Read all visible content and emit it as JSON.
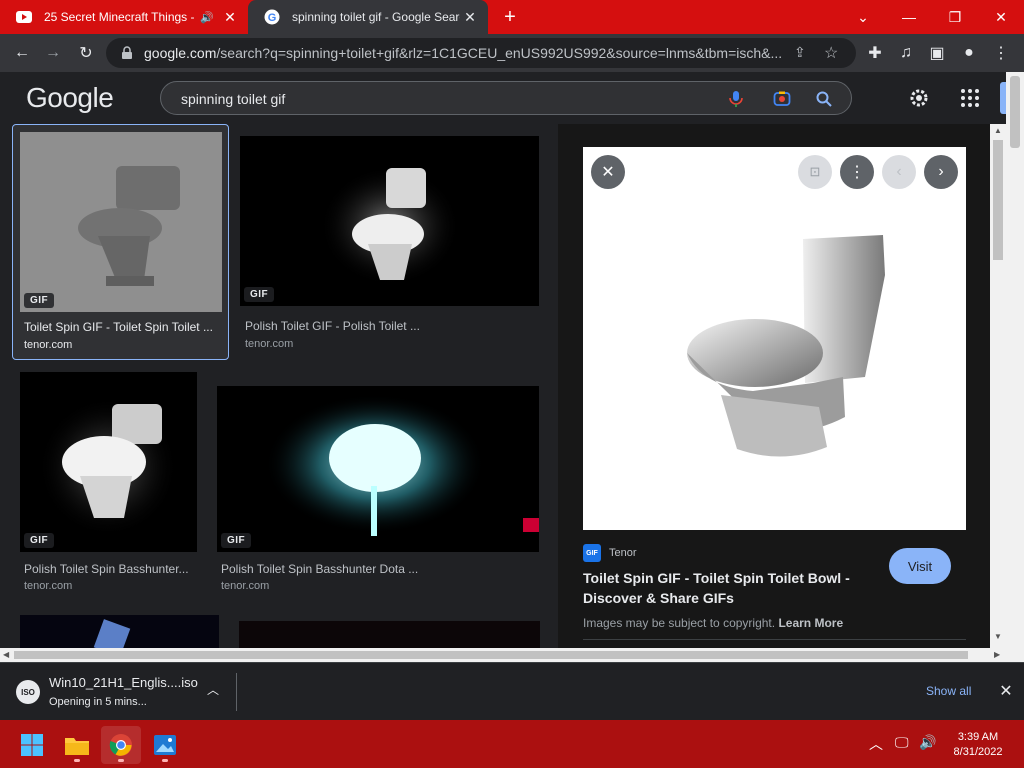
{
  "browser": {
    "tabs": [
      {
        "title": "25 Secret Minecraft Things -",
        "audio": true,
        "active": false
      },
      {
        "title": "spinning toilet gif - Google Search",
        "audio": false,
        "active": true
      }
    ],
    "url_host": "google.com",
    "url_path": "/search?q=spinning+toilet+gif&rlz=1C1GCEU_enUS992US992&source=lnms&tbm=isch&..."
  },
  "google": {
    "logo": "Google",
    "query": "spinning toilet gif"
  },
  "results": [
    {
      "badge": "GIF",
      "title": "Toilet Spin GIF - Toilet Spin Toilet ...",
      "source": "tenor.com"
    },
    {
      "badge": "GIF",
      "title": "Polish Toilet GIF - Polish Toilet ...",
      "source": "tenor.com"
    },
    {
      "badge": "GIF",
      "title": "Polish Toilet Spin Basshunter...",
      "source": "tenor.com"
    },
    {
      "badge": "GIF",
      "title": "Polish Toilet Spin Basshunter Dota ...",
      "source": "tenor.com"
    }
  ],
  "preview": {
    "site": "Tenor",
    "site_logo": "GIF",
    "title": "Toilet Spin GIF - Toilet Spin Toilet Bowl - Discover & Share GIFs",
    "visit_label": "Visit",
    "copyright": "Images may be subject to copyright.",
    "learn_more": "Learn More"
  },
  "downloads": {
    "icon_text": "ISO",
    "file": "Win10_21H1_Englis....iso",
    "status": "Opening in 5 mins...",
    "show_all": "Show all"
  },
  "taskbar": {
    "time": "3:39 AM",
    "date": "8/31/2022"
  },
  "colors": {
    "tab_strip": "#d50f0f",
    "taskbar": "#ab1010",
    "accent": "#8ab4f8",
    "page_bg": "#202124"
  }
}
